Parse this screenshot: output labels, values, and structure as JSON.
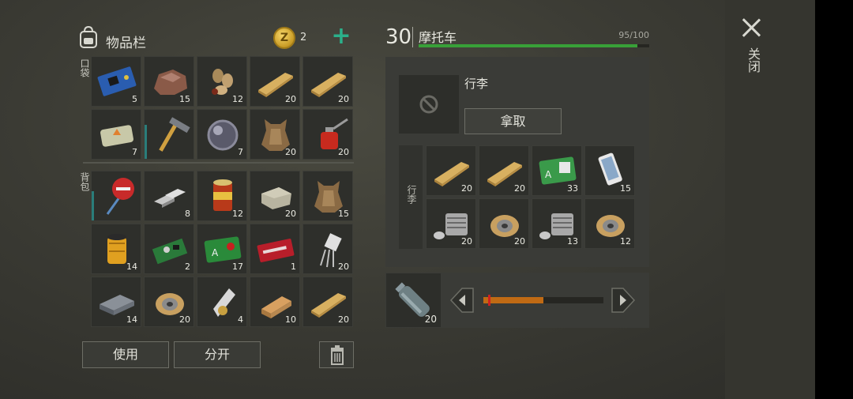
{
  "close": {
    "label": "关闭"
  },
  "inventory": {
    "title": "物品栏",
    "coin_symbol": "Z",
    "coins": "2",
    "pockets_label": "口袋",
    "backpack_label": "背包",
    "pockets": [
      {
        "icon": "circuit-board-icon",
        "count": "5"
      },
      {
        "icon": "copper-ore-icon",
        "count": "15"
      },
      {
        "icon": "seeds-icon",
        "count": "12"
      },
      {
        "icon": "wooden-plank-icon",
        "count": "20"
      },
      {
        "icon": "wooden-plank-icon",
        "count": "20"
      },
      {
        "icon": "explosive-brick-icon",
        "count": "7"
      },
      {
        "icon": "hammer-icon",
        "count": "",
        "durability": 0.7
      },
      {
        "icon": "lens-icon",
        "count": "7"
      },
      {
        "icon": "animal-hide-icon",
        "count": "20"
      },
      {
        "icon": "oil-can-icon",
        "count": "20"
      }
    ],
    "backpack": [
      {
        "icon": "stop-sign-icon",
        "count": "",
        "durability": 0.6
      },
      {
        "icon": "iron-ingots-icon",
        "count": "8"
      },
      {
        "icon": "canned-food-icon",
        "count": "12"
      },
      {
        "icon": "stone-block-icon",
        "count": "20"
      },
      {
        "icon": "animal-hide-icon",
        "count": "15"
      },
      {
        "icon": "oil-filter-icon",
        "count": "14"
      },
      {
        "icon": "green-circuit-icon",
        "count": "2"
      },
      {
        "icon": "biohazard-card-icon",
        "count": "17"
      },
      {
        "icon": "coupon-icon",
        "count": "1"
      },
      {
        "icon": "transistor-icon",
        "count": "20"
      },
      {
        "icon": "metal-box-icon",
        "count": "14"
      },
      {
        "icon": "wire-spool-icon",
        "count": "20"
      },
      {
        "icon": "duct-tape-icon",
        "count": "4"
      },
      {
        "icon": "wooden-block-icon",
        "count": "10"
      },
      {
        "icon": "wooden-plank-icon",
        "count": "20"
      }
    ],
    "use_label": "使用",
    "split_label": "分开"
  },
  "vehicle": {
    "level": "30",
    "name": "摩托车",
    "capacity": "95/100",
    "capacity_fraction": 0.95,
    "trunk_title": "行李",
    "take_label": "拿取",
    "trunk_side_label": "行李",
    "trunk": [
      {
        "icon": "wooden-plank-icon",
        "count": "20"
      },
      {
        "icon": "wooden-plank-icon",
        "count": "20"
      },
      {
        "icon": "access-card-icon",
        "count": "33"
      },
      {
        "icon": "phone-icon",
        "count": "15"
      },
      {
        "icon": "engine-part-icon",
        "count": "20"
      },
      {
        "icon": "wire-spool-icon",
        "count": "20"
      },
      {
        "icon": "engine-part-icon",
        "count": "13"
      },
      {
        "icon": "wire-spool-icon",
        "count": "12"
      }
    ],
    "fuel": {
      "icon": "plastic-bottle-icon",
      "count": "20",
      "level": 0.5
    }
  }
}
